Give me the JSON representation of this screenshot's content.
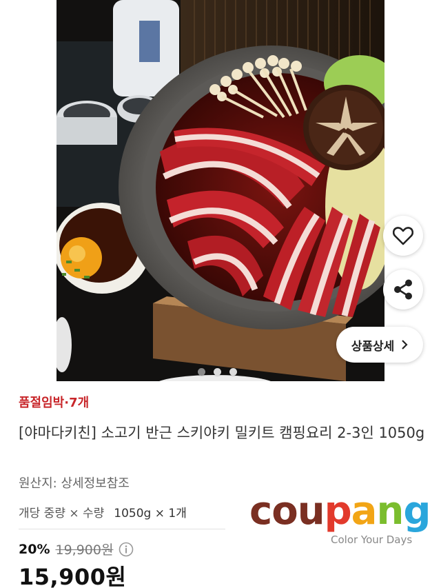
{
  "hero": {
    "detail_button_label": "상품상세",
    "page_indicator": {
      "count": 3,
      "active_index": 0
    }
  },
  "icons": {
    "like": "heart-icon",
    "share": "share-icon",
    "detail_arrow": "chevron-right-icon",
    "price_info": "info-icon"
  },
  "product": {
    "stock_notice": "품절임박·7개",
    "title": "[야마다키친] 소고기 반근 스키야키 밀키트 캠핑요리 2-3인 1050g",
    "origin": "원산지: 상세정보참조",
    "option_label": "개당 중량 × 수량",
    "option_value": "1050g × 1개",
    "discount_rate": "20%",
    "original_price": "19,900원",
    "sale_price": "15,900원"
  },
  "brand": {
    "logo_letters": [
      "c",
      "o",
      "u",
      "p",
      "a",
      "n",
      "g"
    ],
    "logo_colors": [
      "#7a2f22",
      "#7a2f22",
      "#7a2f22",
      "#e23a2c",
      "#f2a516",
      "#7bbd2e",
      "#2aa6dc"
    ],
    "tagline": "Color Your Days"
  },
  "colors": {
    "stock_red": "#c8262a"
  }
}
